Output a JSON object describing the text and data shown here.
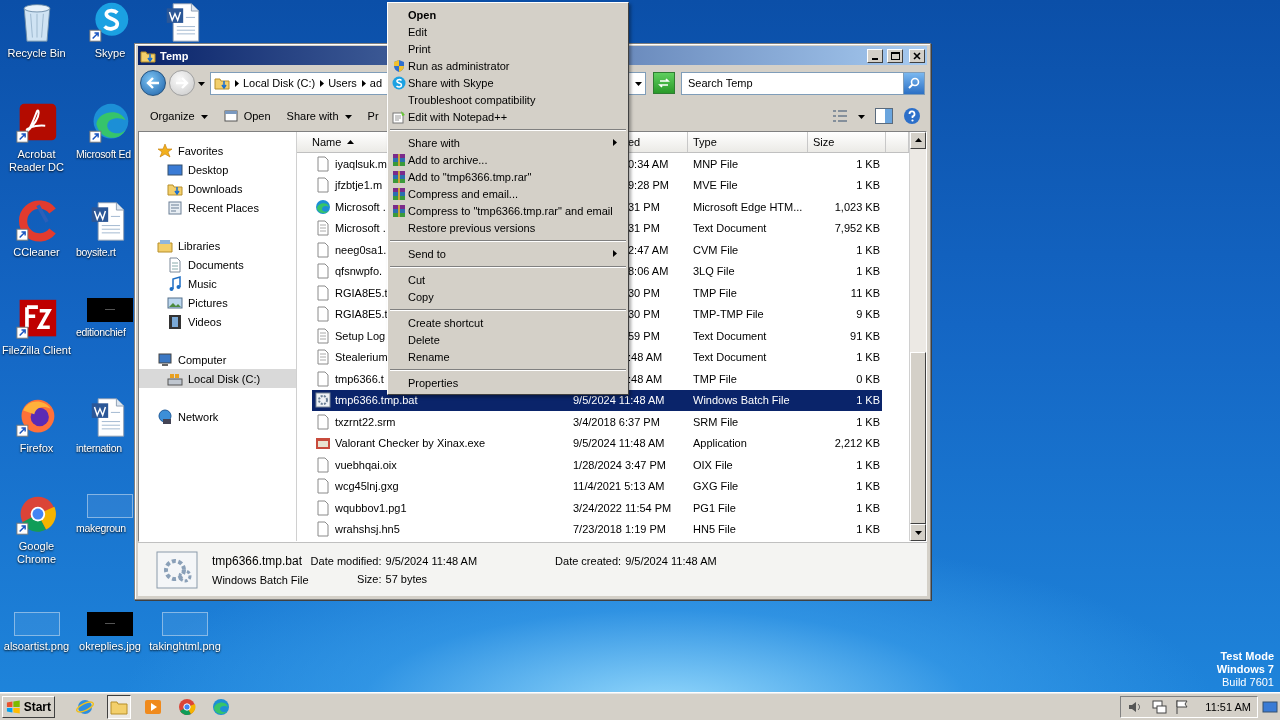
{
  "desktop": {
    "rows": [
      [
        {
          "label": "Recycle Bin",
          "kind": "recycle"
        },
        {
          "label": "Skype",
          "kind": "skype"
        },
        {
          "kind": "word"
        }
      ],
      [
        {
          "label": "Acrobat Reader DC",
          "kind": "acrobat"
        },
        {
          "label": "Microsoft Ed",
          "kind": "edge"
        }
      ],
      [
        {
          "label": "CCleaner",
          "kind": "ccleaner"
        },
        {
          "label": "boysite.rt",
          "kind": "word"
        }
      ],
      [
        {
          "label": "FileZilla Client",
          "kind": "filezilla"
        },
        {
          "label": "editionchief",
          "kind": "black-image"
        }
      ],
      [
        {
          "label": "Firefox",
          "kind": "firefox"
        },
        {
          "label": "internation",
          "kind": "word"
        }
      ],
      [
        {
          "label": "Google Chrome",
          "kind": "chrome"
        },
        {
          "label": "makegroun",
          "kind": "blank-image"
        }
      ],
      [
        {
          "label": "alsoartist.png",
          "kind": "blank-image"
        },
        {
          "label": "okreplies.jpg",
          "kind": "black-image"
        },
        {
          "label": "takinghtml.png",
          "kind": "blank-image"
        }
      ]
    ],
    "system_text": [
      {
        "text": "Test Mode",
        "bold": true
      },
      {
        "text": "Windows 7",
        "bold": true
      },
      {
        "text": "Build 7601",
        "bold": false
      }
    ]
  },
  "explorer": {
    "title": "Temp",
    "address": [
      "Local Disk (C:)",
      "Users",
      "ad"
    ],
    "search": {
      "placeholder": "Search Temp"
    },
    "toolbar": [
      {
        "label": "Organize",
        "kind": "menu"
      },
      {
        "label": "Open",
        "kind": "open"
      },
      {
        "label": "Share with",
        "kind": "menu"
      },
      {
        "label": "Pr",
        "kind": "plain"
      }
    ],
    "navigation": [
      {
        "label": "Favorites",
        "kind": "star",
        "selected": false,
        "children": [
          {
            "label": "Desktop",
            "kind": "desktop",
            "selected": false
          },
          {
            "label": "Downloads",
            "kind": "downloads",
            "selected": false
          },
          {
            "label": "Recent Places",
            "kind": "recent",
            "selected": false
          }
        ]
      },
      {
        "label": "Libraries",
        "kind": "library",
        "selected": false,
        "children": [
          {
            "label": "Documents",
            "kind": "documents",
            "selected": false
          },
          {
            "label": "Music",
            "kind": "music",
            "selected": false
          },
          {
            "label": "Pictures",
            "kind": "pictures",
            "selected": false
          },
          {
            "label": "Videos",
            "kind": "videos",
            "selected": false
          }
        ]
      },
      {
        "label": "Computer",
        "kind": "computer",
        "selected": false,
        "children": [
          {
            "label": "Local Disk (C:)",
            "kind": "disk",
            "selected": true
          }
        ]
      },
      {
        "label": "Network",
        "kind": "network",
        "selected": false
      }
    ],
    "columns": [
      {
        "label": "Name",
        "sorted": true
      },
      {
        "label": "ed",
        "sorted": false
      },
      {
        "label": "Type",
        "sorted": false
      },
      {
        "label": "Size",
        "sorted": false
      }
    ],
    "rows": [
      {
        "name": "iyaqlsuk.m",
        "modified": "0:34 AM",
        "type": "MNP File",
        "size": "1 KB",
        "kind": "blank",
        "selected": false
      },
      {
        "name": "jfzbtje1.m",
        "modified": "9:28 PM",
        "type": "MVE File",
        "size": "1 KB",
        "kind": "blank",
        "selected": false
      },
      {
        "name": "Microsoft .",
        "modified": "31 PM",
        "type": "Microsoft Edge HTM...",
        "size": "1,023 KB",
        "kind": "edge",
        "selected": false
      },
      {
        "name": "Microsoft .",
        "modified": "31 PM",
        "type": "Text Document",
        "size": "7,952 KB",
        "kind": "text",
        "selected": false
      },
      {
        "name": "neeg0sa1.",
        "modified": "2:47 AM",
        "type": "CVM File",
        "size": "1 KB",
        "kind": "blank",
        "selected": false
      },
      {
        "name": "qfsnwpfo.",
        "modified": "8:06 AM",
        "type": "3LQ File",
        "size": "1 KB",
        "kind": "blank",
        "selected": false
      },
      {
        "name": "RGIA8E5.t",
        "modified": "30 PM",
        "type": "TMP File",
        "size": "11 KB",
        "kind": "blank",
        "selected": false
      },
      {
        "name": "RGIA8E5.t",
        "modified": "30 PM",
        "type": "TMP-TMP File",
        "size": "9 KB",
        "kind": "blank",
        "selected": false
      },
      {
        "name": "Setup Log",
        "modified": "59 PM",
        "type": "Text Document",
        "size": "91 KB",
        "kind": "text",
        "selected": false
      },
      {
        "name": "Stealerium",
        "modified": ":48 AM",
        "type": "Text Document",
        "size": "1 KB",
        "kind": "text",
        "selected": false
      },
      {
        "name": "tmp6366.t",
        "modified": ":48 AM",
        "type": "TMP File",
        "size": "0 KB",
        "kind": "blank",
        "selected": false
      },
      {
        "name": "tmp6366.tmp.bat",
        "modified": "9/5/2024 11:48 AM",
        "type": "Windows Batch File",
        "size": "1 KB",
        "kind": "batch",
        "selected": true
      },
      {
        "name": "txzrnt22.srm",
        "modified": "3/4/2018 6:37 PM",
        "type": "SRM File",
        "size": "1 KB",
        "kind": "blank",
        "selected": false
      },
      {
        "name": "Valorant Checker by Xinax.exe",
        "modified": "9/5/2024 11:48 AM",
        "type": "Application",
        "size": "2,212 KB",
        "kind": "app",
        "selected": false
      },
      {
        "name": "vuebhqai.oix",
        "modified": "1/28/2024 3:47 PM",
        "type": "OIX File",
        "size": "1 KB",
        "kind": "blank",
        "selected": false
      },
      {
        "name": "wcg45lnj.gxg",
        "modified": "11/4/2021 5:13 AM",
        "type": "GXG File",
        "size": "1 KB",
        "kind": "blank",
        "selected": false
      },
      {
        "name": "wqubbov1.pg1",
        "modified": "3/24/2022 11:54 PM",
        "type": "PG1 File",
        "size": "1 KB",
        "kind": "blank",
        "selected": false
      },
      {
        "name": "wrahshsj.hn5",
        "modified": "7/23/2018 1:19 PM",
        "type": "HN5 File",
        "size": "1 KB",
        "kind": "blank",
        "selected": false
      }
    ],
    "details": {
      "name": "tmp6366.tmp.bat",
      "type": "Windows Batch File",
      "fields": [
        {
          "label": "Date modified:",
          "value": "9/5/2024 11:48 AM"
        },
        {
          "label": "Size:",
          "value": "57 bytes"
        },
        {
          "label": "Date created:",
          "value": "9/5/2024 11:48 AM"
        }
      ]
    }
  },
  "context_menu": [
    {
      "label": "Open",
      "kind": "plain",
      "default": true
    },
    {
      "label": "Edit",
      "kind": "plain",
      "default": false
    },
    {
      "label": "Print",
      "kind": "plain",
      "default": false
    },
    {
      "label": "Run as administrator",
      "kind": "admin",
      "default": false
    },
    {
      "label": "Share with Skype",
      "kind": "skype",
      "default": false
    },
    {
      "label": "Troubleshoot compatibility",
      "kind": "plain",
      "default": false
    },
    {
      "label": "Edit with Notepad++",
      "kind": "notepad",
      "default": false
    },
    {
      "kind": "separator"
    },
    {
      "label": "Share with",
      "kind": "submenu",
      "default": false
    },
    {
      "label": "Add to archive...",
      "kind": "archive",
      "default": false
    },
    {
      "label": "Add to \"tmp6366.tmp.rar\"",
      "kind": "archive",
      "default": false
    },
    {
      "label": "Compress and email...",
      "kind": "archive",
      "default": false
    },
    {
      "label": "Compress to \"tmp6366.tmp.rar\" and email",
      "kind": "archive",
      "default": false
    },
    {
      "label": "Restore previous versions",
      "kind": "plain",
      "default": false
    },
    {
      "kind": "separator"
    },
    {
      "label": "Send to",
      "kind": "submenu",
      "default": false
    },
    {
      "kind": "separator"
    },
    {
      "label": "Cut",
      "kind": "plain",
      "default": false
    },
    {
      "label": "Copy",
      "kind": "plain",
      "default": false
    },
    {
      "kind": "separator"
    },
    {
      "label": "Create shortcut",
      "kind": "plain",
      "default": false
    },
    {
      "label": "Delete",
      "kind": "plain",
      "default": false
    },
    {
      "label": "Rename",
      "kind": "plain",
      "default": false
    },
    {
      "kind": "separator"
    },
    {
      "label": "Properties",
      "kind": "plain",
      "default": false
    }
  ],
  "taskbar": {
    "start": "Start",
    "apps": [
      {
        "kind": "ie",
        "active": false
      },
      {
        "kind": "explorer",
        "active": true
      },
      {
        "kind": "media",
        "active": false
      },
      {
        "kind": "chrome",
        "active": false
      },
      {
        "kind": "edge",
        "active": false
      }
    ],
    "clock": "11:51 AM"
  }
}
